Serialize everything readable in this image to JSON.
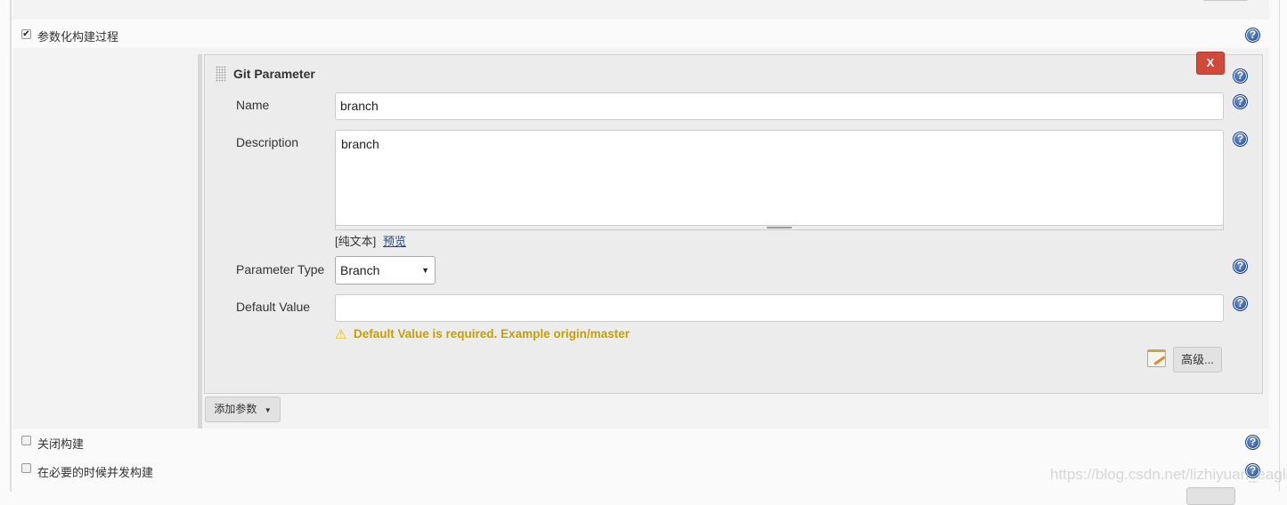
{
  "options": [
    {
      "label": "参数化构建过程",
      "checked": true
    },
    {
      "label": "关闭构建",
      "checked": false
    },
    {
      "label": "在必要的时候并发构建",
      "checked": false
    }
  ],
  "param": {
    "title": "Git Parameter",
    "delete_label": "X",
    "name_label": "Name",
    "name_value": "branch",
    "desc_label": "Description",
    "desc_value": "branch",
    "plain_text": "[纯文本]",
    "preview": "预览",
    "type_label": "Parameter Type",
    "type_value": "Branch",
    "default_label": "Default Value",
    "default_value": "",
    "warning": "Default Value is required. Example origin/master",
    "advanced": "高级..."
  },
  "add_param": "添加参数",
  "watermark": "https://blog.csdn.net/lizhiyuan_eagle",
  "colors": {
    "delete": "#d24939",
    "warning": "#c4a000",
    "link": "#204a87"
  }
}
